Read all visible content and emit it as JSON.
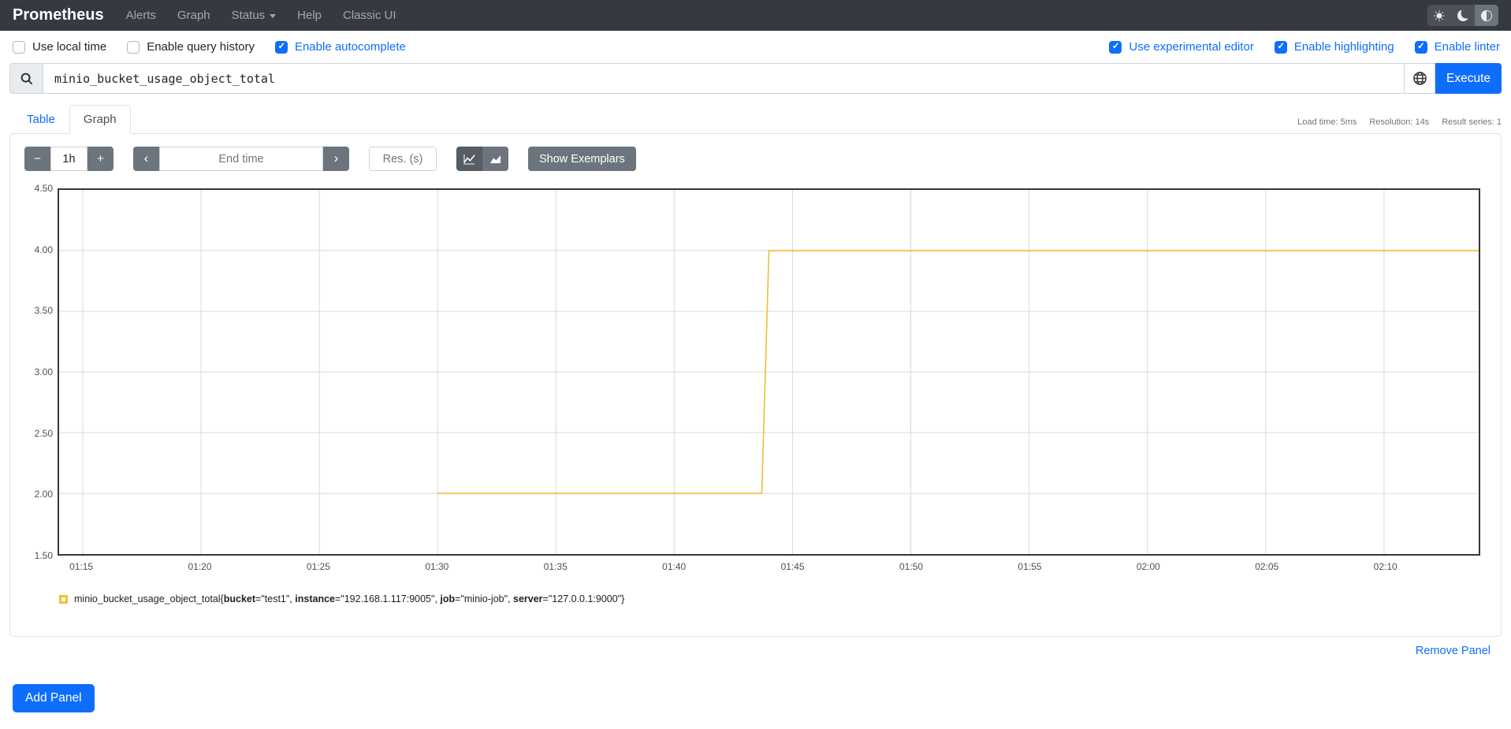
{
  "navbar": {
    "brand": "Prometheus",
    "items": [
      {
        "label": "Alerts"
      },
      {
        "label": "Graph"
      },
      {
        "label": "Status",
        "has_caret": true
      },
      {
        "label": "Help"
      },
      {
        "label": "Classic UI"
      }
    ],
    "theme_buttons": [
      {
        "icon": "light-theme-sun-icon",
        "active": false
      },
      {
        "icon": "dark-theme-moon-icon",
        "active": false
      },
      {
        "icon": "auto-theme-contrast-icon",
        "active": true
      }
    ]
  },
  "settings": {
    "left": [
      {
        "label": "Use local time",
        "checked": false
      },
      {
        "label": "Enable query history",
        "checked": false
      },
      {
        "label": "Enable autocomplete",
        "checked": true
      }
    ],
    "right": [
      {
        "label": "Use experimental editor",
        "checked": true
      },
      {
        "label": "Enable highlighting",
        "checked": true
      },
      {
        "label": "Enable linter",
        "checked": true
      }
    ]
  },
  "query": {
    "value": "minio_bucket_usage_object_total",
    "execute_label": "Execute"
  },
  "stats": {
    "load_time": "Load time: 5ms",
    "resolution": "Resolution: 14s",
    "result_series": "Result series: 1"
  },
  "tabs": {
    "table_label": "Table",
    "graph_label": "Graph",
    "active": "Graph"
  },
  "toolbar": {
    "decrease_label": "−",
    "range_value": "1h",
    "increase_label": "+",
    "prev_label": "‹",
    "end_time_placeholder": "End time",
    "next_label": "›",
    "res_placeholder": "Res. (s)",
    "show_exemplars_label": "Show Exemplars"
  },
  "chart_data": {
    "type": "line",
    "title": "",
    "xlabel": "",
    "ylabel": "",
    "xlim": [
      "01:14",
      "02:14"
    ],
    "ylim": [
      1.5,
      4.5
    ],
    "xticks": [
      "01:15",
      "01:20",
      "01:25",
      "01:30",
      "01:35",
      "01:40",
      "01:45",
      "01:50",
      "01:55",
      "02:00",
      "02:05",
      "02:10"
    ],
    "yticks": [
      1.5,
      2.0,
      2.5,
      3.0,
      3.5,
      4.0,
      4.5
    ],
    "grid": true,
    "legend_position": "bottom-left",
    "series": [
      {
        "name": "minio_bucket_usage_object_total{bucket=\"test1\", instance=\"192.168.1.117:9005\", job=\"minio-job\", server=\"127.0.0.1:9000\"}",
        "color": "#edc240",
        "points": [
          {
            "x": "01:30",
            "y": 2
          },
          {
            "x": "01:43.7",
            "y": 2
          },
          {
            "x": "01:44",
            "y": 4
          },
          {
            "x": "02:14",
            "y": 4
          }
        ]
      }
    ]
  },
  "legend": {
    "metric": "minio_bucket_usage_object_total",
    "labels": [
      {
        "name": "bucket",
        "value": "test1"
      },
      {
        "name": "instance",
        "value": "192.168.1.117:9005"
      },
      {
        "name": "job",
        "value": "minio-job"
      },
      {
        "name": "server",
        "value": "127.0.0.1:9000"
      }
    ],
    "color": "#edc240"
  },
  "panel_footer": {
    "remove_label": "Remove Panel"
  },
  "add_panel": {
    "label": "Add Panel"
  },
  "colors": {
    "accent": "#0d6efd",
    "series": "#edc240",
    "navbar_bg": "#343a40"
  }
}
